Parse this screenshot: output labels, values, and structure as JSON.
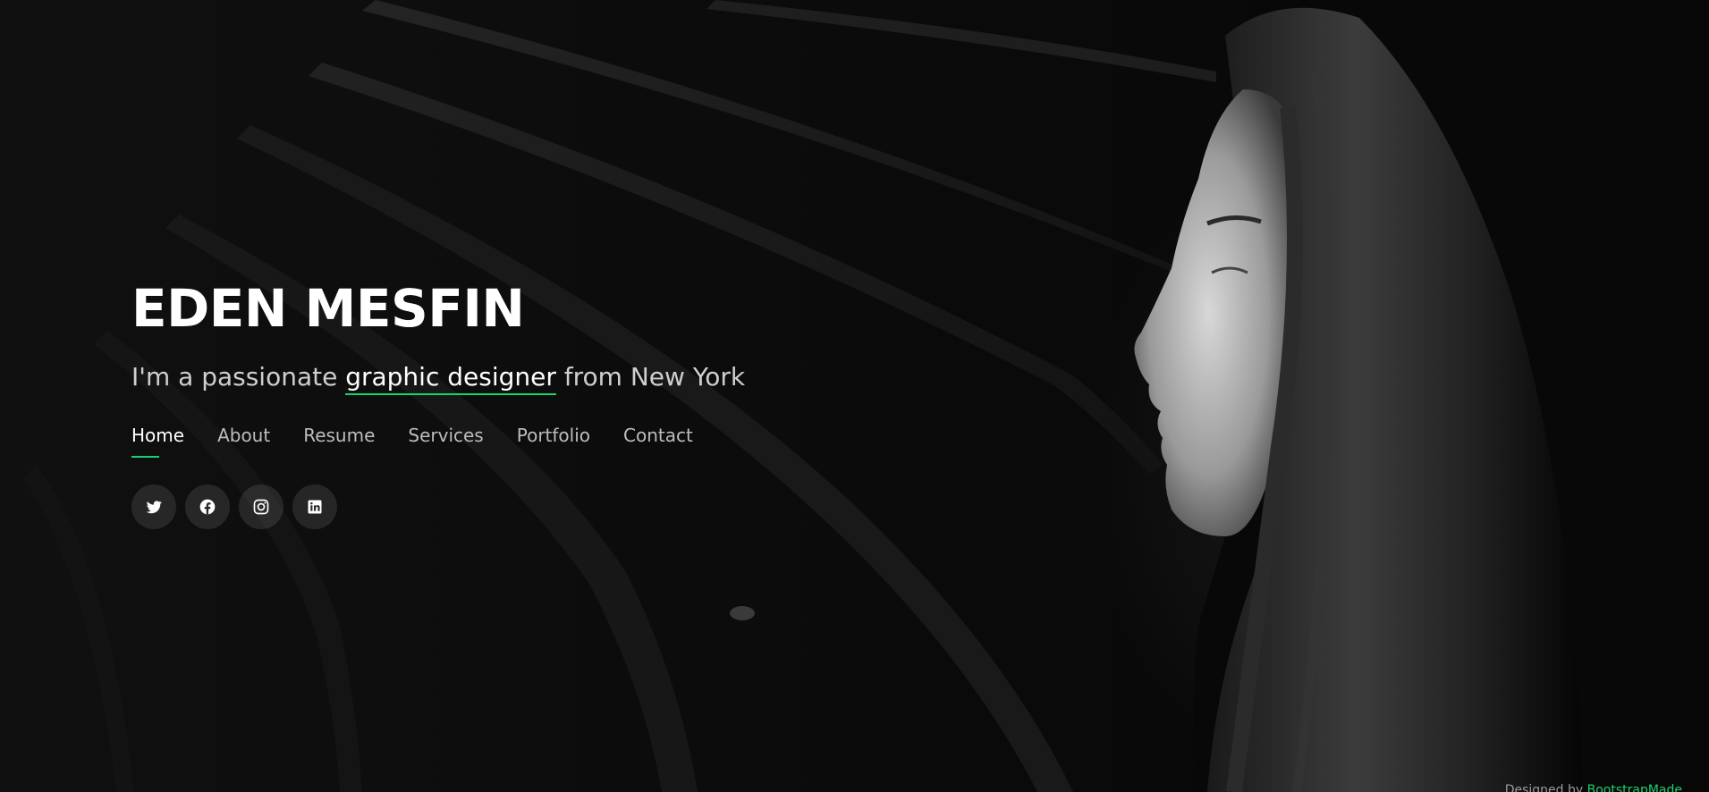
{
  "hero": {
    "name": "EDEN MESFIN",
    "tagline_prefix": "I'm a passionate ",
    "tagline_highlight": "graphic designer",
    "tagline_suffix": " from New York"
  },
  "nav": {
    "items": [
      {
        "label": "Home",
        "active": true
      },
      {
        "label": "About"
      },
      {
        "label": "Resume"
      },
      {
        "label": "Services"
      },
      {
        "label": "Portfolio"
      },
      {
        "label": "Contact"
      }
    ]
  },
  "social": {
    "icons": [
      "twitter-icon",
      "facebook-icon",
      "instagram-icon",
      "linkedin-icon"
    ]
  },
  "footer": {
    "credit_prefix": "Designed by ",
    "credit_link": "BootstrapMade"
  },
  "colors": {
    "accent": "#18d26e",
    "background": "#0b0b0b",
    "text_primary": "#ffffff",
    "text_secondary": "#cfcfcf"
  }
}
